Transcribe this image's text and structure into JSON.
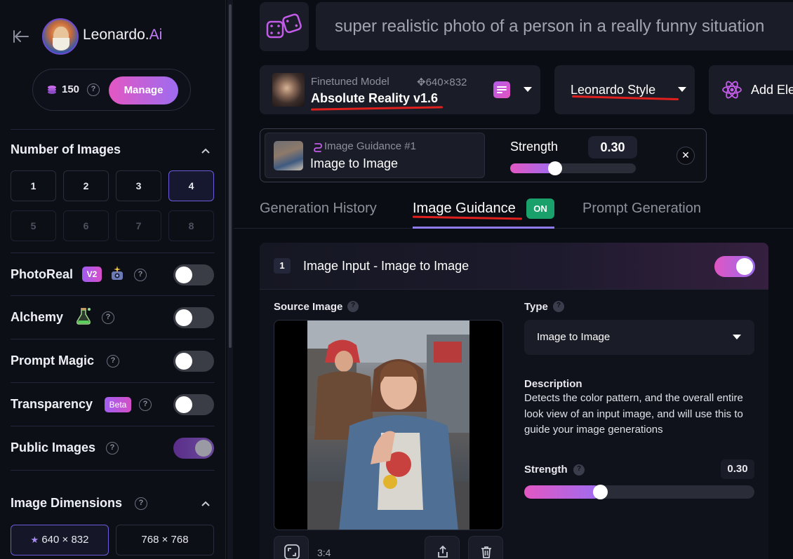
{
  "sidebar": {
    "brand": {
      "name": "Leonardo.",
      "suffix": "Ai"
    },
    "credits": {
      "count": "150",
      "help": "?",
      "manage_label": "Manage"
    },
    "number_of_images": {
      "title": "Number of Images",
      "options": [
        "1",
        "2",
        "3",
        "4",
        "5",
        "6",
        "7",
        "8"
      ],
      "selected": "4"
    },
    "toggles": {
      "photoreal": {
        "label": "PhotoReal",
        "badge": "V2",
        "on": false
      },
      "alchemy": {
        "label": "Alchemy",
        "on": false
      },
      "prompt_magic": {
        "label": "Prompt Magic",
        "on": false
      },
      "transparency": {
        "label": "Transparency",
        "badge": "Beta",
        "on": false
      },
      "public_images": {
        "label": "Public Images",
        "on": true
      }
    },
    "help_glyph": "?",
    "image_dimensions": {
      "title": "Image Dimensions",
      "options": [
        "640 × 832",
        "768 × 768"
      ],
      "selected": "640 × 832"
    }
  },
  "prompt": {
    "text": "super realistic photo of a person in a really funny situation"
  },
  "model": {
    "type_label": "Finetuned Model",
    "size": "640×832",
    "name": "Absolute Reality v1.6"
  },
  "style": {
    "name": "Leonardo Style"
  },
  "add_elements": {
    "label": "Add Elements"
  },
  "guidance_summary": {
    "title": "Image Guidance #1",
    "type": "Image to Image",
    "strength_label": "Strength",
    "strength_value": "0.30",
    "strength_fraction": 0.3
  },
  "tabs": [
    {
      "label": "Generation History"
    },
    {
      "label": "Image Guidance",
      "badge": "ON"
    },
    {
      "label": "Prompt Generation"
    }
  ],
  "panel": {
    "number": "1",
    "title": "Image Input - Image to Image",
    "enabled": true,
    "source_label": "Source Image",
    "type_label": "Type",
    "type_value": "Image to Image",
    "description_label": "Description",
    "description": "Detects the color pattern, and the overall entire look view of an input image, and will use this to guide your image generations",
    "strength_label": "Strength",
    "strength_value": "0.30",
    "strength_fraction": 0.3,
    "aspect_ratio": "3:4"
  },
  "colors": {
    "accent_gradient_start": "#e357c3",
    "accent_gradient_end": "#9d6cf0",
    "on_badge": "#1aa06a",
    "annotation_red": "#e0201d"
  }
}
